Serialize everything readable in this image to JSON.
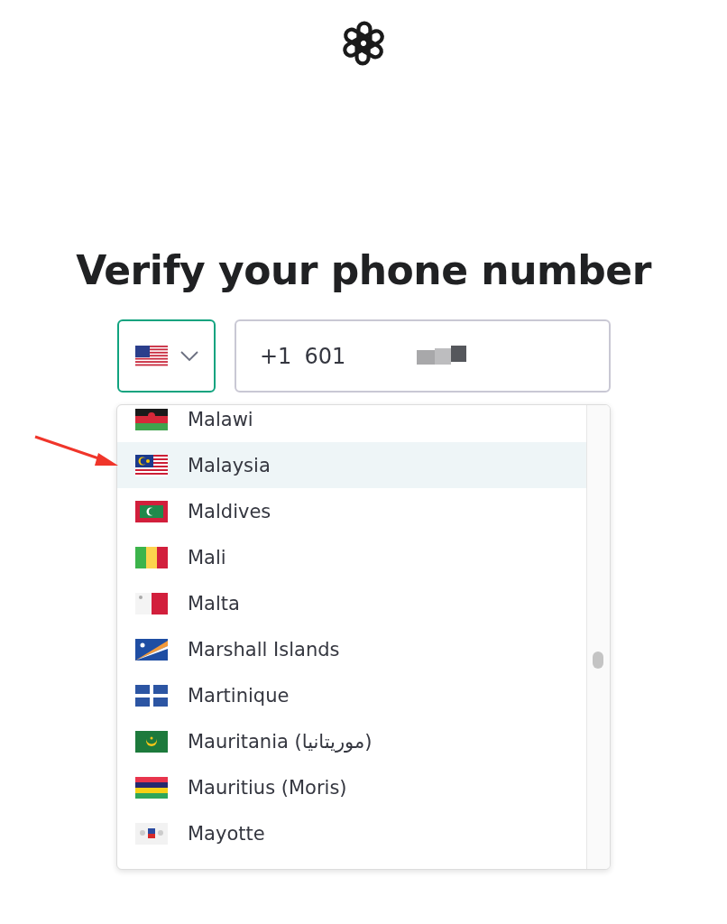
{
  "title": "Verify your phone number",
  "country_select": {
    "expanded": true
  },
  "phone": {
    "prefix": "+1",
    "value": "601"
  },
  "countries": [
    {
      "name": "Malawi",
      "selected": false
    },
    {
      "name": "Malaysia",
      "selected": true
    },
    {
      "name": "Maldives",
      "selected": false
    },
    {
      "name": "Mali",
      "selected": false
    },
    {
      "name": "Malta",
      "selected": false
    },
    {
      "name": "Marshall Islands",
      "selected": false
    },
    {
      "name": "Martinique",
      "selected": false
    },
    {
      "name": "Mauritania (موريتانيا)",
      "selected": false
    },
    {
      "name": "Mauritius (Moris)",
      "selected": false
    },
    {
      "name": "Mayotte",
      "selected": false
    }
  ]
}
